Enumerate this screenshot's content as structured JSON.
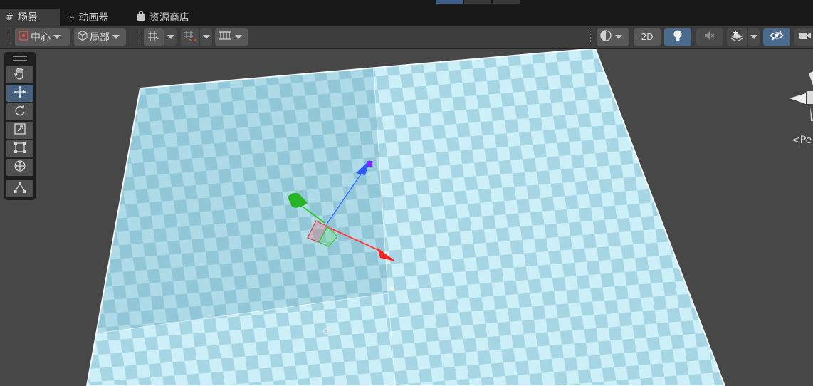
{
  "tabs": [
    {
      "label": "场景",
      "icon": "hash-icon",
      "active": true
    },
    {
      "label": "动画器",
      "icon": "animator-icon",
      "active": false
    },
    {
      "label": "资源商店",
      "icon": "shopping-bag-icon",
      "active": false
    }
  ],
  "toolbar": {
    "pivot_label": "中心",
    "space_label": "局部",
    "twod_label": "2D"
  },
  "tools": [
    "hand-tool",
    "move-tool",
    "rotate-tool",
    "scale-tool",
    "rect-tool",
    "transform-tool",
    "custom-editor-tool"
  ],
  "selected_tool": "move-tool",
  "orientation": {
    "projection_label": "Pe"
  },
  "colors": {
    "accent": "#4a6a8e",
    "panel": "#3c3c3c",
    "tabbar": "#191919",
    "plane_light": "#d2f2fb",
    "plane_dark": "#9cccdc",
    "axis_x": "#ff2a2a",
    "axis_y": "#2ec92e",
    "axis_z": "#3a6cff"
  }
}
